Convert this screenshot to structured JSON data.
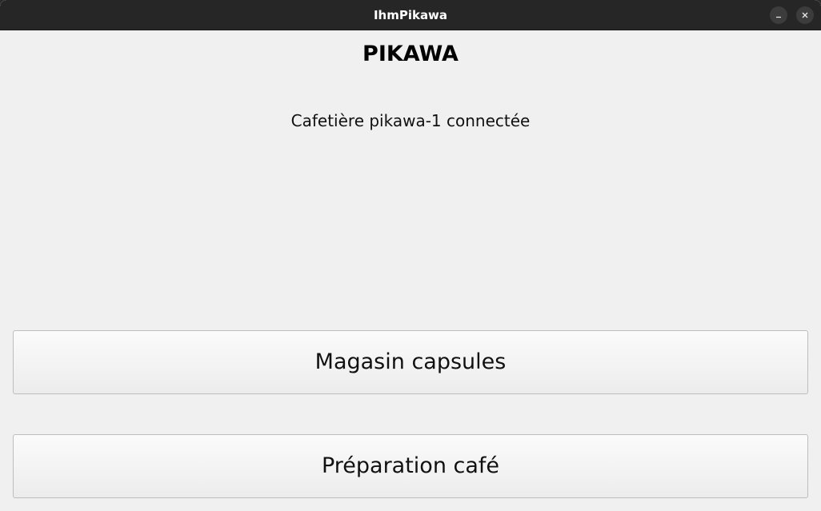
{
  "window": {
    "title": "IhmPikawa",
    "minimize_icon": "minimize-icon",
    "close_icon": "close-icon"
  },
  "main": {
    "heading": "PIKAWA",
    "status": "Cafetière pikawa-1 connectée",
    "buttons": [
      {
        "label": "Magasin capsules"
      },
      {
        "label": "Préparation café"
      }
    ]
  }
}
